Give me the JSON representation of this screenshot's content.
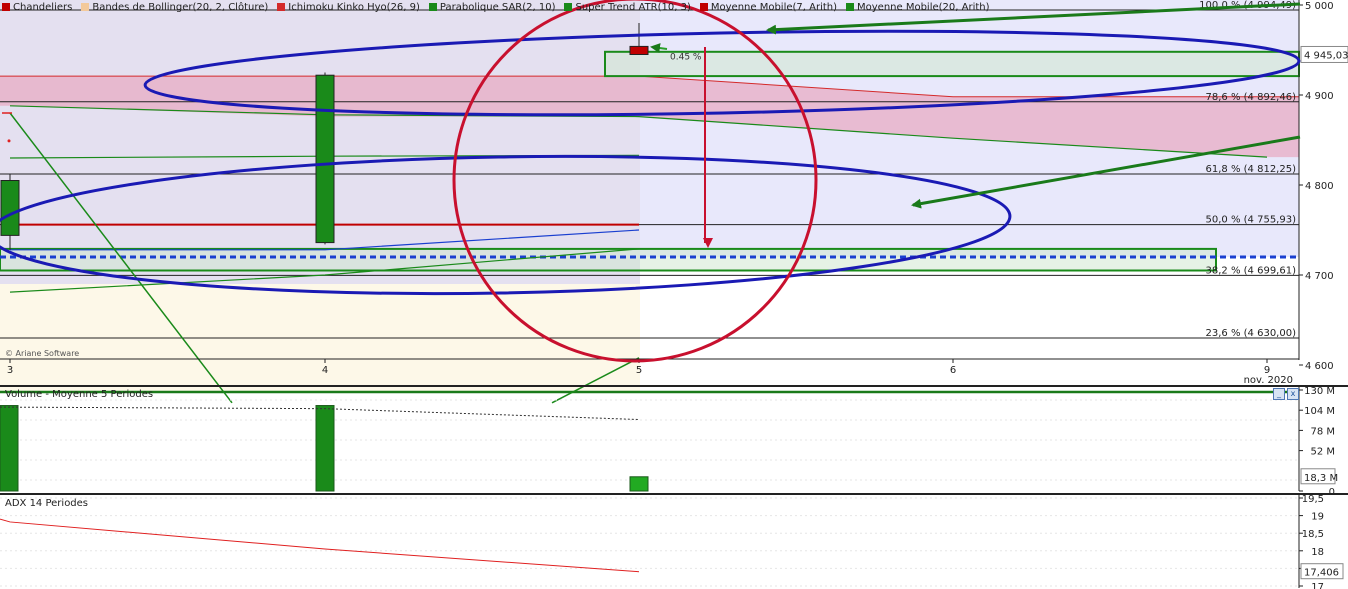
{
  "legend": [
    {
      "label": "Chandeliers",
      "color": "#c00000"
    },
    {
      "label": "Bandes de Bollinger(20, 2, Clôture)",
      "color": "#f3c99b"
    },
    {
      "label": "Ichimoku Kinko Hyo(26, 9)",
      "color": "#d42a2a"
    },
    {
      "label": "Parabolique SAR(2, 10)",
      "color": "#1a8a1a"
    },
    {
      "label": "Super Trend ATR(10, 3)",
      "color": "#1a8a1a"
    },
    {
      "label": "Moyenne Mobile(7, Arith)",
      "color": "#c00000"
    },
    {
      "label": "Moyenne Mobile(20, Arith)",
      "color": "#1a8a1a"
    }
  ],
  "copyright": "© Ariane Software",
  "volume_title": "Volume - Moyenne 5 Periodes",
  "adx_title": "ADX 14 Periodes",
  "window_buttons": {
    "minimize": "_",
    "close": "x"
  },
  "chart_data": [
    {
      "type": "candlestick",
      "name": "price",
      "x_tick_labels": [
        "3",
        "4",
        "5",
        "6",
        "9"
      ],
      "x_period_label": "nov. 2020",
      "ylim": [
        4557,
        5006
      ],
      "y_ticks": [
        4600,
        4700,
        4800,
        4900,
        5000
      ],
      "y_tick_labels": [
        "4 600",
        "4 700",
        "4 800",
        "4 900",
        "5 000"
      ],
      "candles": [
        {
          "x": "3",
          "open": 4744,
          "high": 4812,
          "low": 4728,
          "close": 4805,
          "color": "#1a8a1a"
        },
        {
          "x": "4",
          "open": 4736,
          "high": 4925,
          "low": 4734,
          "close": 4922,
          "color": "#1a8a1a"
        },
        {
          "x": "5",
          "open": 4954,
          "high": 4980,
          "low": 4945,
          "close": 4945,
          "color": "#c00000"
        }
      ],
      "current_price_label": "4 945,03",
      "change_label": "0.45 %",
      "fibonacci": [
        {
          "label": "100,0 % (4 994,49)",
          "value": 4994.49
        },
        {
          "label": "78,6 % (4 892,46)",
          "value": 4892.46
        },
        {
          "label": "61,8 % (4 812,25)",
          "value": 4812.25
        },
        {
          "label": "50,0 % (4 755,93)",
          "value": 4755.93
        },
        {
          "label": "38,2 % (4 699,61)",
          "value": 4699.61
        },
        {
          "label": "23,6 % (4 630,00)",
          "value": 4630.0
        }
      ],
      "support_line": 4570,
      "dashed_level": 4720,
      "zones": [
        {
          "from": 4921,
          "to": 4948,
          "color": "#1a8a1a"
        },
        {
          "from": 4705,
          "to": 4729,
          "color": "#1a8a1a"
        }
      ],
      "ichimoku_cloud": [
        {
          "x": "3",
          "top": 4921,
          "bottom": 4888
        },
        {
          "x": "4",
          "top": 4921,
          "bottom": 4876
        },
        {
          "x": "5",
          "top": 4921,
          "bottom": 4876
        },
        {
          "x": "6",
          "top": 4898,
          "bottom": 4852
        },
        {
          "x": "9",
          "top": 4898,
          "bottom": 4831
        }
      ],
      "lines": [
        {
          "name": "Moyenne Mobile(20, Arith)",
          "color": "#1a8a1a",
          "points": [
            [
              "3",
              4888
            ],
            [
              "4",
              4878
            ],
            [
              "5",
              4876
            ],
            [
              "6",
              4852
            ],
            [
              "9",
              4831
            ]
          ]
        },
        {
          "name": "Moyenne Mobile(7, Arith)",
          "color": "#c00000",
          "points": [
            [
              "3",
              4755.93
            ],
            [
              "5",
              4755.93
            ]
          ]
        },
        {
          "name": "Super Trend ATR(10, 3)",
          "color": "#1a8a1a",
          "points": [
            [
              "3",
              4830
            ],
            [
              "4",
              4832
            ],
            [
              "5",
              4833
            ]
          ]
        },
        {
          "name": "Bandes de Bollinger(20, 2, Clôture)",
          "color": "#1a3fd0",
          "points": [
            [
              "3",
              4728
            ],
            [
              "4",
              4728
            ],
            [
              "5",
              4750
            ]
          ]
        },
        {
          "name": "Bandes de Bollinger lower",
          "color": "#1a8a1a",
          "points": [
            [
              "3",
              4681
            ],
            [
              "4",
              4700
            ],
            [
              "5",
              4729
            ]
          ]
        }
      ]
    },
    {
      "type": "bar",
      "name": "volume",
      "categories": [
        "3",
        "4",
        "5"
      ],
      "values": [
        110,
        110,
        18.3
      ],
      "ylim": [
        0,
        130
      ],
      "y_ticks": [
        0,
        26,
        52,
        78,
        104,
        130
      ],
      "y_tick_labels": [
        "0",
        "26 M",
        "52 M",
        "78 M",
        "104 M",
        "130 M"
      ],
      "average_line": [
        [
          "4",
          106
        ],
        [
          "5",
          92
        ]
      ],
      "current_label": "18,3 M",
      "color": "#1a8a1a",
      "last_color": "#22aa22"
    },
    {
      "type": "line",
      "name": "adx",
      "x": [
        "3",
        "4",
        "5"
      ],
      "values": [
        18.82,
        18.05,
        17.406
      ],
      "ylim": [
        17,
        19.5
      ],
      "y_ticks": [
        17,
        17.5,
        18,
        18.5,
        19,
        19.5
      ],
      "y_tick_labels": [
        "17",
        "",
        "18",
        "18,5",
        "19",
        "19,5"
      ],
      "current_label": "17,406",
      "color": "#e02020"
    }
  ]
}
